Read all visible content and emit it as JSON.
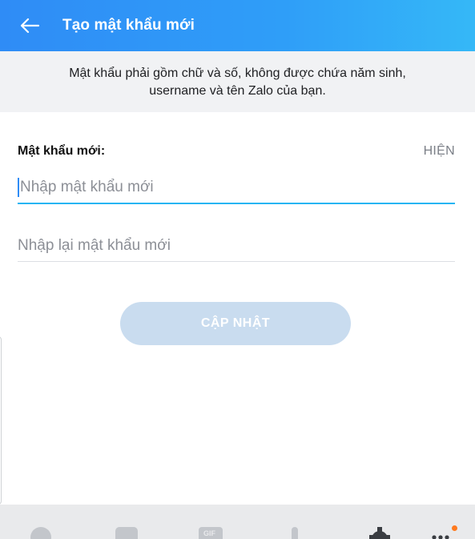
{
  "header": {
    "title": "Tạo mật khẩu mới",
    "back_icon": "arrow-left-icon"
  },
  "notice": {
    "line1": "Mật khẩu phải gồm chữ và số, không được chứa năm sinh,",
    "line2": "username và tên Zalo của bạn."
  },
  "form": {
    "new_password_label": "Mật khẩu mới:",
    "show_toggle": "HIỆN",
    "new_password_placeholder": "Nhập mật khẩu mới",
    "confirm_password_placeholder": "Nhập lại mật khẩu mới",
    "update_button": "CẬP NHẬT"
  },
  "toolbar": {
    "icons": [
      "emoji-icon",
      "sticker-icon",
      "gif-icon",
      "microphone-icon",
      "gear-icon",
      "more-icon"
    ],
    "gif_label": "GIF"
  },
  "colors": {
    "header_start": "#2f8cf6",
    "header_end": "#35b8f7",
    "active_underline": "#27b5f2",
    "button_disabled": "#c9dcef",
    "notification_dot": "#ff7a1f"
  }
}
